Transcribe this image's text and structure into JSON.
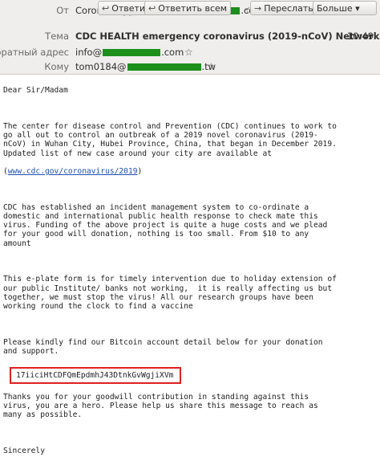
{
  "header": {
    "from_label": "От",
    "from_value": "Corona Support <info@",
    "from_value_end": ".com>",
    "subject_label": "Тема",
    "subject_value": "CDC HEALTH emergency coronavirus (2019-nCoV) Network",
    "time": "10:49",
    "reply_to_label": "Обратный адрес",
    "reply_to_value": "info@",
    "reply_to_end": ".com",
    "to_label": "Кому",
    "to_value": "tom0184@",
    "to_end": ".tw",
    "buttons": {
      "reply": "Ответить",
      "reply_all": "Ответить всем",
      "forward": "Переслать",
      "more": "Больше"
    }
  },
  "body": {
    "greeting": "Dear Sir/Madam",
    "p1": "The center for disease control and Prevention (CDC) continues to work to\ngo all out to control an outbreak of a 2019 novel coronavirus (2019-\nnCoV) in Wuhan City, Hubei Province, China, that began in December 2019.\nUpdated list of new case around your city are available at",
    "link_prefix": "(",
    "link": "www.cdc.gov/coronavirus/2019",
    "link_suffix": ")",
    "p2": "CDC has established an incident management system to co-ordinate a\ndomestic and international public health response to check mate this\nvirus. Funding of the above project is quite a huge costs and we plead\nfor your good will donation, nothing is too small. From $10 to any\namount",
    "p3": "This e-plate form is for timely intervention due to holiday extension of\nour public Institute/ banks not working,  it is really affecting us but\ntogether, we must stop the virus! All our research groups have been\nworking round the clock to find a vaccine",
    "p4": "Please kindly find our Bitcoin account detail below for your donation\nand support.",
    "btc": "17iiciHtCDFQmEpdmhJ43DtnkGvWgjiXVm",
    "p5": "Thanks you for your goodwill contribution in standing against this\nvirus, you are a hero. Please help us share this message to reach as\nmany as possible.",
    "closing": "Sincerely"
  }
}
